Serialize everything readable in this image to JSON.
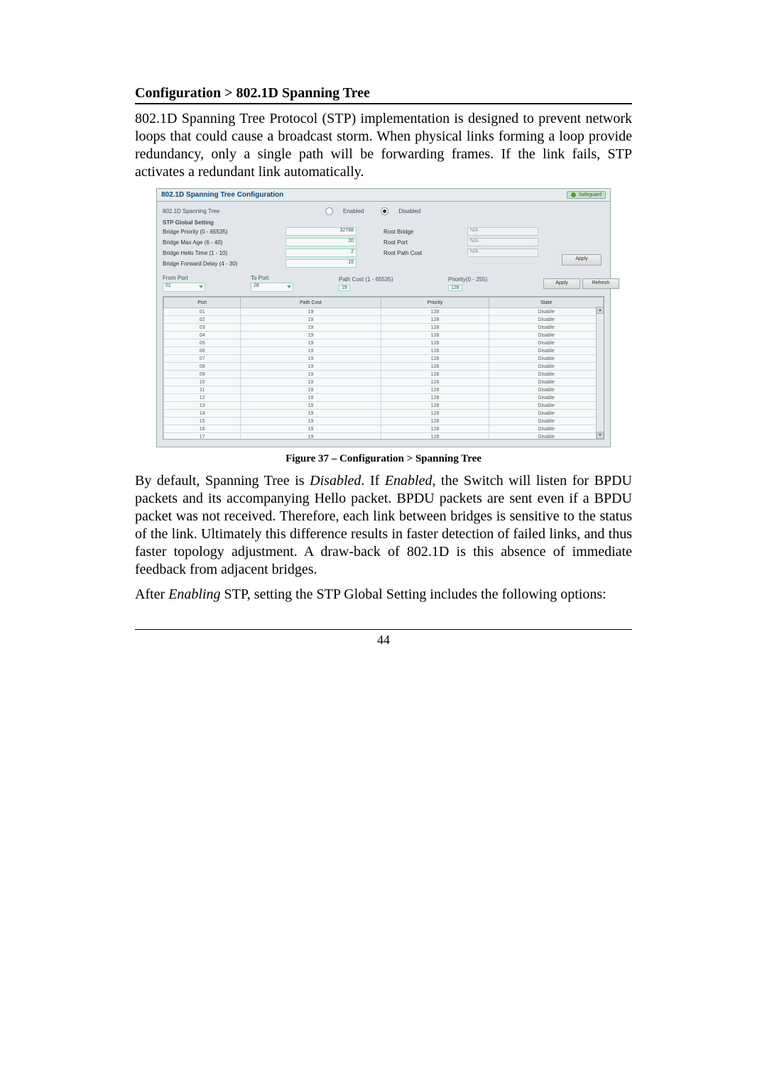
{
  "section_title": "Configuration > 802.1D Spanning Tree",
  "intro_text": "802.1D Spanning Tree Protocol (STP) implementation is designed to prevent network loops that could cause a broadcast storm. When physical links forming a loop provide redundancy, only a single path will be forwarding frames. If the link fails, STP activates a redundant link automatically.",
  "panel": {
    "title": "802.1D Spanning Tree Configuration",
    "safeguard": "Safeguard",
    "stp_label": "802.1D Spanning Tree",
    "radio_enabled": "Enabled",
    "radio_disabled": "Disabled",
    "global_title": "STP Global Setting",
    "bridge_priority_label": "Bridge Priority (0 - 65535)",
    "bridge_priority_value": "32768",
    "bridge_maxage_label": "Bridge Max Age (6 - 40)",
    "bridge_maxage_value": "20",
    "bridge_hello_label": "Bridge Hello Time (1 - 10)",
    "bridge_hello_value": "2",
    "bridge_fwd_label": "Bridge Forward Delay (4 - 30)",
    "bridge_fwd_value": "15",
    "root_bridge_label": "Root Bridge",
    "root_bridge_value": "N/A",
    "root_port_label": "Root Port",
    "root_port_value": "N/A",
    "root_path_label": "Root Path Cost",
    "root_path_value": "N/A",
    "apply": "Apply",
    "from_port_label": "From Port",
    "from_port_value": "01",
    "to_port_label": "To Port",
    "to_port_value": "28",
    "path_cost_label": "Path Cost (1 - 65535)",
    "path_cost_value": "19",
    "port_priority_label": "Priority(0 - 255)",
    "port_priority_value": "128",
    "apply2": "Apply",
    "refresh": "Refresh",
    "table": {
      "headers": [
        "Port",
        "Path Cost",
        "Priority",
        "State"
      ],
      "rows": [
        [
          "01",
          "19",
          "128",
          "Disable"
        ],
        [
          "02",
          "19",
          "128",
          "Disable"
        ],
        [
          "03",
          "19",
          "128",
          "Disable"
        ],
        [
          "04",
          "19",
          "128",
          "Disable"
        ],
        [
          "05",
          "19",
          "128",
          "Disable"
        ],
        [
          "06",
          "19",
          "128",
          "Disable"
        ],
        [
          "07",
          "19",
          "128",
          "Disable"
        ],
        [
          "08",
          "19",
          "128",
          "Disable"
        ],
        [
          "09",
          "19",
          "128",
          "Disable"
        ],
        [
          "10",
          "19",
          "128",
          "Disable"
        ],
        [
          "11",
          "19",
          "128",
          "Disable"
        ],
        [
          "12",
          "19",
          "128",
          "Disable"
        ],
        [
          "13",
          "19",
          "128",
          "Disable"
        ],
        [
          "14",
          "19",
          "128",
          "Disable"
        ],
        [
          "15",
          "19",
          "128",
          "Disable"
        ],
        [
          "16",
          "19",
          "128",
          "Disable"
        ],
        [
          "17",
          "19",
          "128",
          "Disable"
        ]
      ]
    }
  },
  "figure_caption": "Figure 37 – Configuration > Spanning Tree",
  "body_after_1_a": "By default, Spanning Tree is ",
  "body_after_1_b": "Disabled",
  "body_after_1_c": ". If ",
  "body_after_1_d": "Enabled",
  "body_after_1_e": ", the Switch will listen for BPDU packets and its accompanying Hello packet. BPDU packets are sent even if a BPDU packet was not received. Therefore, each link between bridges is sensitive to the status of the link. Ultimately this difference results in faster detection of failed links, and thus faster topology adjustment. A draw-back of 802.1D is this absence of immediate feedback from adjacent bridges.",
  "body_after_2_a": "After ",
  "body_after_2_b": "Enabling",
  "body_after_2_c": " STP, setting the STP Global Setting includes the following options:",
  "page_number": "44"
}
